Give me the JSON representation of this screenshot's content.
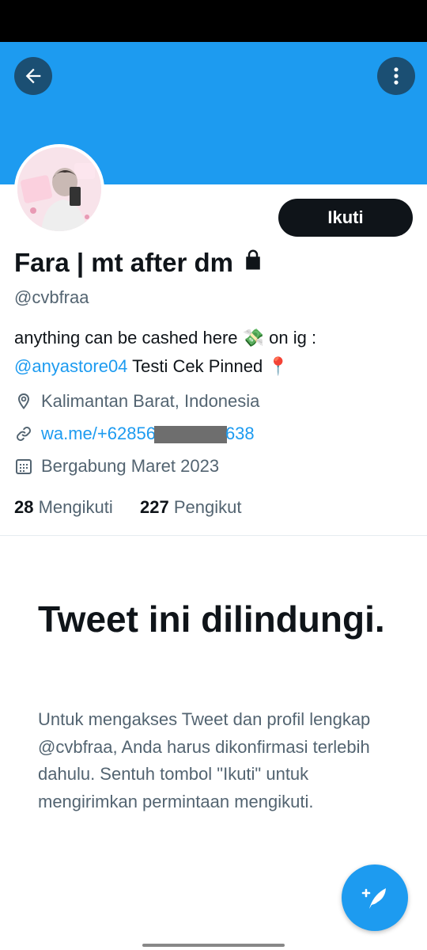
{
  "profile": {
    "name": "Fara | mt after dm",
    "handle": "@cvbfraa",
    "follow_label": "Ikuti",
    "bio_line1": "anything can be cashed here 💸  on ig :",
    "bio_link": "@anyastore04",
    "bio_line2_rest": " Testi Cek Pinned 📍",
    "location": "Kalimantan Barat, Indonesia",
    "website_prefix": "wa.me/+62856",
    "website_suffix": "638",
    "joined": "Bergabung Maret 2023",
    "following_count": "28",
    "following_label": "Mengikuti",
    "followers_count": "227",
    "followers_label": "Pengikut"
  },
  "protected": {
    "title": "Tweet ini dilindungi.",
    "body": "Untuk mengakses Tweet dan profil lengkap @cvbfraa, Anda harus dikonfirmasi terlebih dahulu. Sentuh tombol \"Ikuti\" untuk mengirimkan permintaan mengikuti."
  },
  "colors": {
    "banner": "#1d9bf0",
    "accent": "#1d9bf0",
    "follow_button": "#0f1419",
    "secondary_text": "#536471"
  },
  "icons": {
    "back": "arrow-left-icon",
    "more": "more-vertical-icon",
    "lock": "lock-icon",
    "location": "location-pin-icon",
    "link": "link-icon",
    "calendar": "calendar-icon",
    "compose": "compose-tweet-icon"
  }
}
